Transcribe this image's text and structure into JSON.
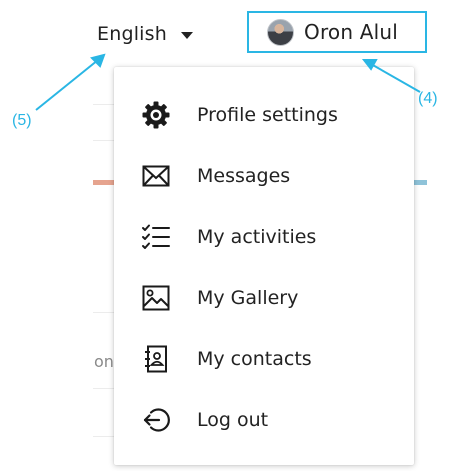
{
  "header": {
    "language": {
      "label": "English",
      "icon": "chevron-down-icon"
    },
    "user": {
      "name": "Oron Alul",
      "avatar": "avatar"
    }
  },
  "menu": {
    "items": [
      {
        "label": "Profile settings",
        "icon": "gear-icon"
      },
      {
        "label": "Messages",
        "icon": "envelope-icon"
      },
      {
        "label": "My activities",
        "icon": "checklist-icon"
      },
      {
        "label": "My Gallery",
        "icon": "image-icon"
      },
      {
        "label": "My contacts",
        "icon": "contacts-book-icon"
      },
      {
        "label": "Log out",
        "icon": "logout-icon"
      }
    ]
  },
  "background": {
    "fragment": "on"
  },
  "annotations": {
    "user_chip": "(4)",
    "language": "(5)"
  },
  "colors": {
    "highlight": "#2ab6e4",
    "text": "#222222"
  }
}
